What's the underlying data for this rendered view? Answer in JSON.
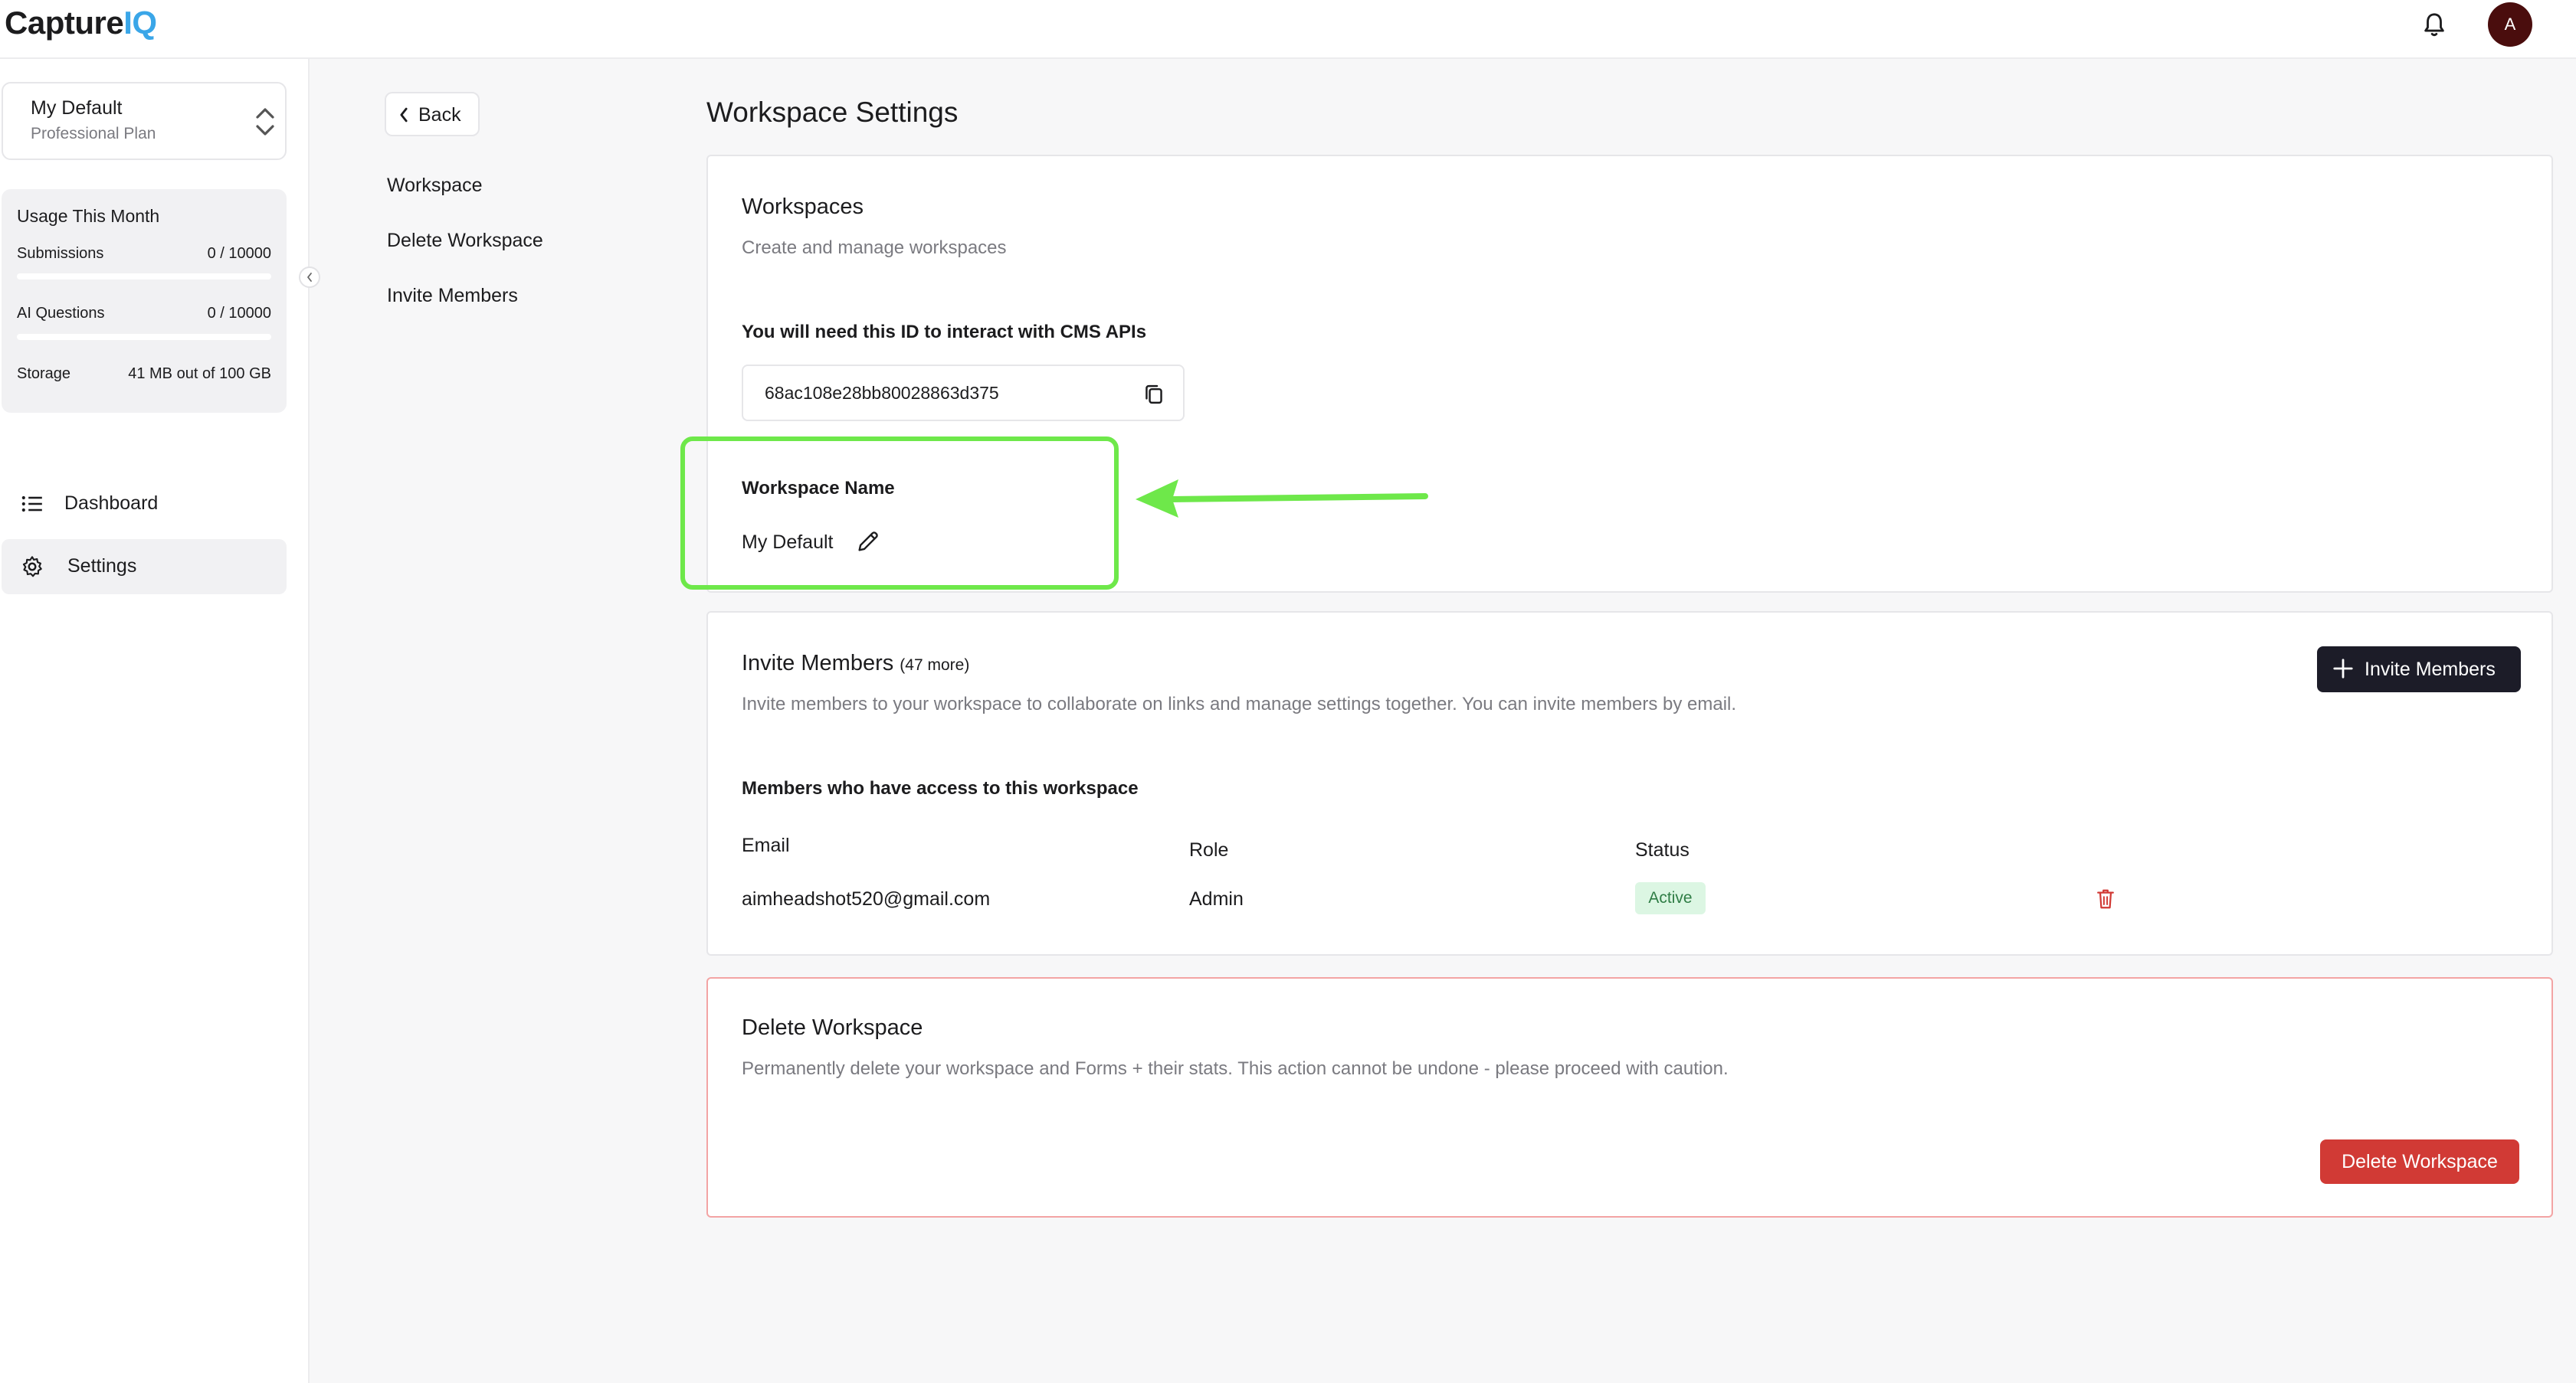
{
  "app": {
    "logo_main": "Capture",
    "logo_accent": "IQ",
    "avatar_initial": "A"
  },
  "sidebar": {
    "workspace": {
      "name": "My Default",
      "plan": "Professional Plan"
    },
    "usage": {
      "title": "Usage This Month",
      "rows": [
        {
          "label": "Submissions",
          "value": "0 / 10000",
          "fraction": 0.0
        },
        {
          "label": "AI Questions",
          "value": "0 / 10000",
          "fraction": 0.0
        },
        {
          "label": "Storage",
          "value": "41 MB out of 100 GB"
        }
      ]
    },
    "nav": [
      {
        "label": "Dashboard",
        "icon": "list-icon",
        "active": false
      },
      {
        "label": "Settings",
        "icon": "gear-icon",
        "active": true
      }
    ]
  },
  "subnav": {
    "back_label": "Back",
    "items": [
      "Workspace",
      "Delete Workspace",
      "Invite Members"
    ]
  },
  "main": {
    "page_title": "Workspace Settings",
    "workspaces_card": {
      "title": "Workspaces",
      "description": "Create and manage workspaces",
      "id_label": "You will need this ID to interact with CMS APIs",
      "id_value": "68ac108e28bb80028863d375",
      "name_label": "Workspace Name",
      "name_value": "My Default"
    },
    "invite_card": {
      "title": "Invite Members",
      "more": "(47 more)",
      "description": "Invite members to your workspace to collaborate on links and manage settings together. You can invite members by email.",
      "button_label": "Invite Members",
      "members_heading": "Members who have access to this workspace",
      "columns": [
        "Email",
        "Role",
        "Status"
      ],
      "rows": [
        {
          "email": "aimheadshot520@gmail.com",
          "role": "Admin",
          "status": "Active"
        }
      ]
    },
    "delete_card": {
      "title": "Delete Workspace",
      "description": "Permanently delete your workspace and Forms + their stats. This action cannot be undone - please proceed with caution.",
      "button_label": "Delete Workspace"
    }
  },
  "colors": {
    "accent": "#3aa6e8",
    "highlight": "#6ee84a",
    "danger": "#d13a35",
    "dark_button": "#1c1c28",
    "active_badge_bg": "#dcf6e3",
    "active_badge_text": "#2f7d45"
  }
}
